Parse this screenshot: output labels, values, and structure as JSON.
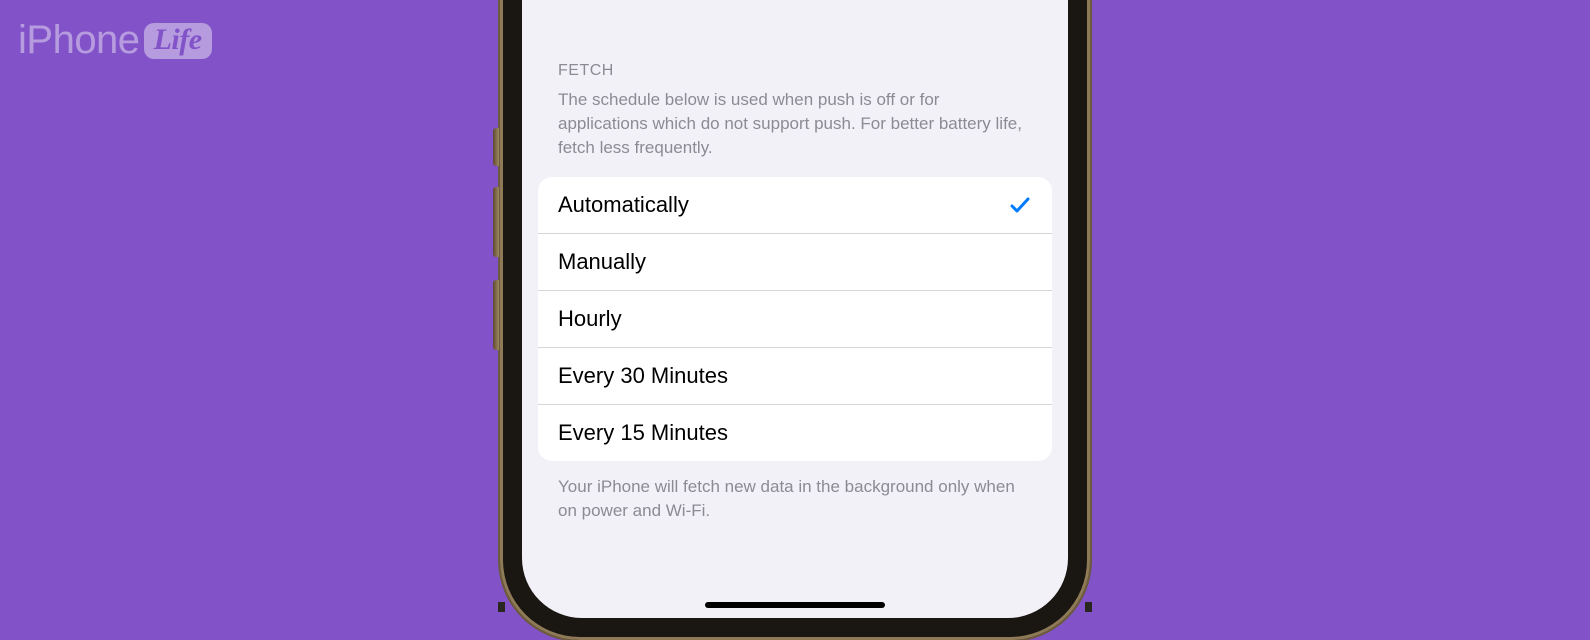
{
  "watermark": {
    "brand_prefix": "iPhone",
    "brand_suffix": "Life"
  },
  "fetch": {
    "header": "FETCH",
    "description": "The schedule below is used when push is off or for applications which do not support push. For better battery life, fetch less frequently.",
    "options": [
      {
        "label": "Automatically",
        "selected": true
      },
      {
        "label": "Manually",
        "selected": false
      },
      {
        "label": "Hourly",
        "selected": false
      },
      {
        "label": "Every 30 Minutes",
        "selected": false
      },
      {
        "label": "Every 15 Minutes",
        "selected": false
      }
    ],
    "footer": "Your iPhone will fetch new data in the background only when on power and Wi-Fi."
  }
}
